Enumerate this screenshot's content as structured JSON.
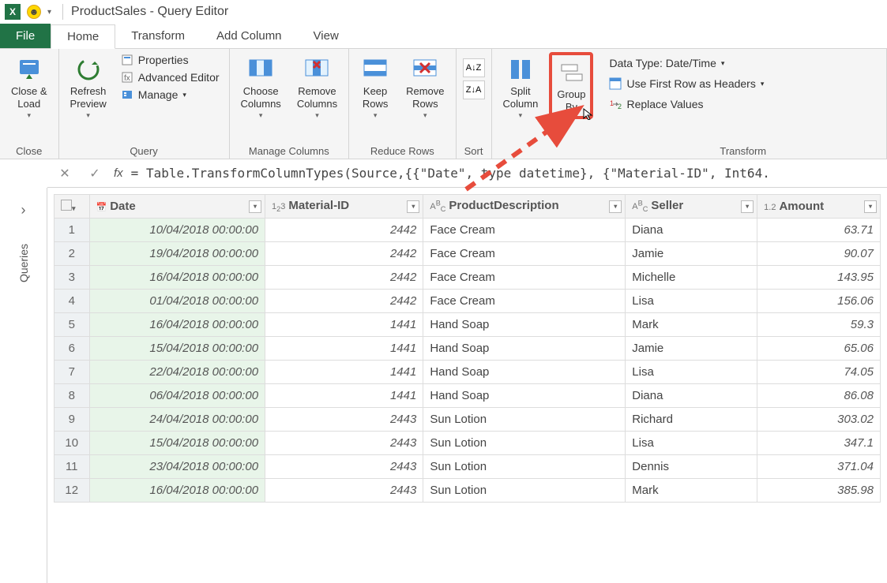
{
  "title": "ProductSales - Query Editor",
  "tabs": {
    "file": "File",
    "home": "Home",
    "transform": "Transform",
    "add_column": "Add Column",
    "view": "View"
  },
  "ribbon": {
    "close": {
      "close_load": "Close &\nLoad",
      "group": "Close"
    },
    "query": {
      "refresh": "Refresh\nPreview",
      "properties": "Properties",
      "advanced": "Advanced Editor",
      "manage": "Manage",
      "group": "Query"
    },
    "manage_cols": {
      "choose": "Choose\nColumns",
      "remove": "Remove\nColumns",
      "group": "Manage Columns"
    },
    "reduce": {
      "keep": "Keep\nRows",
      "remove": "Remove\nRows",
      "group": "Reduce Rows"
    },
    "sort": {
      "group": "Sort"
    },
    "split": "Split\nColumn",
    "groupby": "Group\nBy",
    "transform": {
      "datatype": "Data Type: Date/Time",
      "headers": "Use First Row as Headers",
      "replace": "Replace Values",
      "group": "Transform"
    }
  },
  "formula": "= Table.TransformColumnTypes(Source,{{\"Date\", type datetime}, {\"Material-ID\", Int64.",
  "sidebar": {
    "queries": "Queries"
  },
  "columns": {
    "date": "Date",
    "material": "Material-ID",
    "product": "ProductDescription",
    "seller": "Seller",
    "amount": "Amount"
  },
  "rows": [
    {
      "n": "1",
      "date": "10/04/2018 00:00:00",
      "mat": "2442",
      "prod": "Face Cream",
      "seller": "Diana",
      "amt": "63.71"
    },
    {
      "n": "2",
      "date": "19/04/2018 00:00:00",
      "mat": "2442",
      "prod": "Face Cream",
      "seller": "Jamie",
      "amt": "90.07"
    },
    {
      "n": "3",
      "date": "16/04/2018 00:00:00",
      "mat": "2442",
      "prod": "Face Cream",
      "seller": "Michelle",
      "amt": "143.95"
    },
    {
      "n": "4",
      "date": "01/04/2018 00:00:00",
      "mat": "2442",
      "prod": "Face Cream",
      "seller": "Lisa",
      "amt": "156.06"
    },
    {
      "n": "5",
      "date": "16/04/2018 00:00:00",
      "mat": "1441",
      "prod": "Hand Soap",
      "seller": "Mark",
      "amt": "59.3"
    },
    {
      "n": "6",
      "date": "15/04/2018 00:00:00",
      "mat": "1441",
      "prod": "Hand Soap",
      "seller": "Jamie",
      "amt": "65.06"
    },
    {
      "n": "7",
      "date": "22/04/2018 00:00:00",
      "mat": "1441",
      "prod": "Hand Soap",
      "seller": "Lisa",
      "amt": "74.05"
    },
    {
      "n": "8",
      "date": "06/04/2018 00:00:00",
      "mat": "1441",
      "prod": "Hand Soap",
      "seller": "Diana",
      "amt": "86.08"
    },
    {
      "n": "9",
      "date": "24/04/2018 00:00:00",
      "mat": "2443",
      "prod": "Sun Lotion",
      "seller": "Richard",
      "amt": "303.02"
    },
    {
      "n": "10",
      "date": "15/04/2018 00:00:00",
      "mat": "2443",
      "prod": "Sun Lotion",
      "seller": "Lisa",
      "amt": "347.1"
    },
    {
      "n": "11",
      "date": "23/04/2018 00:00:00",
      "mat": "2443",
      "prod": "Sun Lotion",
      "seller": "Dennis",
      "amt": "371.04"
    },
    {
      "n": "12",
      "date": "16/04/2018 00:00:00",
      "mat": "2443",
      "prod": "Sun Lotion",
      "seller": "Mark",
      "amt": "385.98"
    }
  ]
}
